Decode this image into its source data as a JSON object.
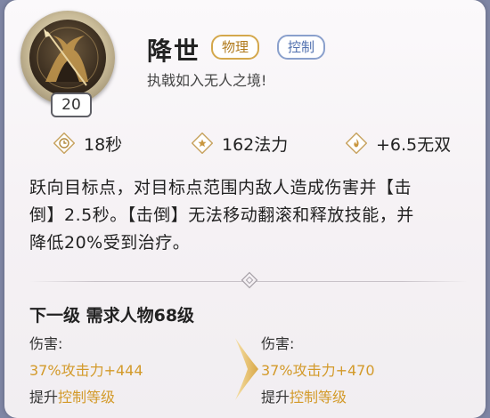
{
  "skill": {
    "name": "降世",
    "level": "20",
    "tags": [
      "物理",
      "控制"
    ],
    "quote": "执戟如入无人之境!",
    "icon": "minotaur-warrior-portrait"
  },
  "stats": [
    {
      "icon": "clock-icon",
      "text": "18秒"
    },
    {
      "icon": "star-icon",
      "text": "162法力"
    },
    {
      "icon": "flame-icon",
      "text": "+6.5无双"
    }
  ],
  "description": {
    "line1": "跃向目标点，对目标点范围内敌人造成伤害并【击",
    "line2": "倒】2.5秒。【击倒】无法移动翻滚和释放技能，并",
    "line3": "降低20%受到治疗。"
  },
  "next_level": {
    "title": "下一级 需求人物68级",
    "current": {
      "damage_label": "伤害:",
      "damage_value": "37%攻击力+444",
      "upgrade_prefix": "提升",
      "upgrade_highlight": "控制等级"
    },
    "next": {
      "damage_label": "伤害:",
      "damage_value": "37%攻击力+470",
      "upgrade_prefix": "提升",
      "upgrade_highlight": "控制等级"
    }
  },
  "colors": {
    "gold": "#d39a2a",
    "tag_physical": "#d4a84c",
    "tag_control": "#8aa0cc"
  }
}
